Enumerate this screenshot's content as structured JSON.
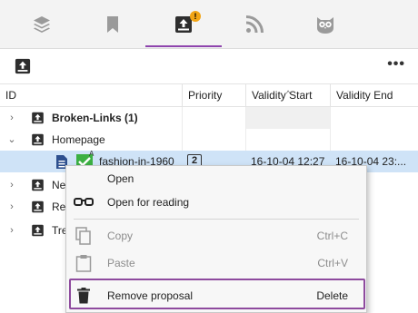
{
  "tabs": [
    {
      "name": "layers",
      "icon": "layers-icon"
    },
    {
      "name": "bookmark",
      "icon": "bookmark-icon"
    },
    {
      "name": "inbox",
      "icon": "inbox-upload-icon",
      "badge": "!",
      "active": true
    },
    {
      "name": "rss",
      "icon": "rss-icon"
    },
    {
      "name": "owl",
      "icon": "owl-icon"
    }
  ],
  "toolbar": {
    "upload_icon": "inbox-upload-icon",
    "more_label": "•••"
  },
  "columns": [
    "ID",
    "Priority",
    "Validity Start",
    "Validity End"
  ],
  "rows": [
    {
      "caret": "›",
      "label": "Broken-Links (1)",
      "bold": true
    },
    {
      "caret": "⌄",
      "label": "Homepage",
      "bold": false
    },
    {
      "label": "fashion-in-1960",
      "priority": "2",
      "validity_start": "16-10-04 12:27",
      "validity_end": "16-10-04 23:..."
    },
    {
      "caret": "›",
      "label": "Ne"
    },
    {
      "caret": "›",
      "label": "Re"
    },
    {
      "caret": "›",
      "label": "Tre"
    }
  ],
  "context_menu": {
    "items": [
      {
        "label": "Open",
        "icon": ""
      },
      {
        "label": "Open for reading",
        "icon": "glasses-icon"
      },
      {
        "label": "Copy",
        "shortcut": "Ctrl+C",
        "icon": "copy-icon",
        "disabled": true
      },
      {
        "label": "Paste",
        "shortcut": "Ctrl+V",
        "icon": "clipboard-icon",
        "disabled": true
      },
      {
        "label": "Remove proposal",
        "shortcut": "Delete",
        "icon": "trash-icon"
      }
    ]
  },
  "colors": {
    "accent": "#8e44ad",
    "badge": "#f2a516",
    "selected_row": "#cfe3f7",
    "check": "#3cb043"
  }
}
